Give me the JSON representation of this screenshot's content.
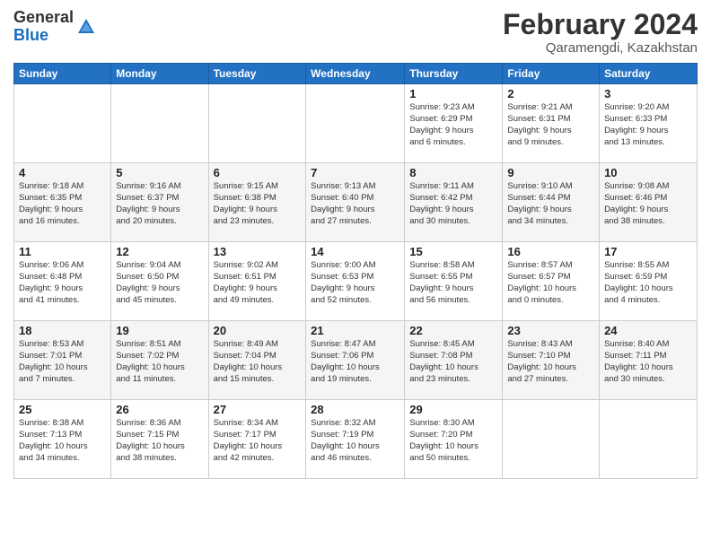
{
  "logo": {
    "general": "General",
    "blue": "Blue"
  },
  "header": {
    "month_year": "February 2024",
    "location": "Qaramengdi, Kazakhstan"
  },
  "days_of_week": [
    "Sunday",
    "Monday",
    "Tuesday",
    "Wednesday",
    "Thursday",
    "Friday",
    "Saturday"
  ],
  "weeks": [
    [
      {
        "day": "",
        "info": ""
      },
      {
        "day": "",
        "info": ""
      },
      {
        "day": "",
        "info": ""
      },
      {
        "day": "",
        "info": ""
      },
      {
        "day": "1",
        "info": "Sunrise: 9:23 AM\nSunset: 6:29 PM\nDaylight: 9 hours\nand 6 minutes."
      },
      {
        "day": "2",
        "info": "Sunrise: 9:21 AM\nSunset: 6:31 PM\nDaylight: 9 hours\nand 9 minutes."
      },
      {
        "day": "3",
        "info": "Sunrise: 9:20 AM\nSunset: 6:33 PM\nDaylight: 9 hours\nand 13 minutes."
      }
    ],
    [
      {
        "day": "4",
        "info": "Sunrise: 9:18 AM\nSunset: 6:35 PM\nDaylight: 9 hours\nand 16 minutes."
      },
      {
        "day": "5",
        "info": "Sunrise: 9:16 AM\nSunset: 6:37 PM\nDaylight: 9 hours\nand 20 minutes."
      },
      {
        "day": "6",
        "info": "Sunrise: 9:15 AM\nSunset: 6:38 PM\nDaylight: 9 hours\nand 23 minutes."
      },
      {
        "day": "7",
        "info": "Sunrise: 9:13 AM\nSunset: 6:40 PM\nDaylight: 9 hours\nand 27 minutes."
      },
      {
        "day": "8",
        "info": "Sunrise: 9:11 AM\nSunset: 6:42 PM\nDaylight: 9 hours\nand 30 minutes."
      },
      {
        "day": "9",
        "info": "Sunrise: 9:10 AM\nSunset: 6:44 PM\nDaylight: 9 hours\nand 34 minutes."
      },
      {
        "day": "10",
        "info": "Sunrise: 9:08 AM\nSunset: 6:46 PM\nDaylight: 9 hours\nand 38 minutes."
      }
    ],
    [
      {
        "day": "11",
        "info": "Sunrise: 9:06 AM\nSunset: 6:48 PM\nDaylight: 9 hours\nand 41 minutes."
      },
      {
        "day": "12",
        "info": "Sunrise: 9:04 AM\nSunset: 6:50 PM\nDaylight: 9 hours\nand 45 minutes."
      },
      {
        "day": "13",
        "info": "Sunrise: 9:02 AM\nSunset: 6:51 PM\nDaylight: 9 hours\nand 49 minutes."
      },
      {
        "day": "14",
        "info": "Sunrise: 9:00 AM\nSunset: 6:53 PM\nDaylight: 9 hours\nand 52 minutes."
      },
      {
        "day": "15",
        "info": "Sunrise: 8:58 AM\nSunset: 6:55 PM\nDaylight: 9 hours\nand 56 minutes."
      },
      {
        "day": "16",
        "info": "Sunrise: 8:57 AM\nSunset: 6:57 PM\nDaylight: 10 hours\nand 0 minutes."
      },
      {
        "day": "17",
        "info": "Sunrise: 8:55 AM\nSunset: 6:59 PM\nDaylight: 10 hours\nand 4 minutes."
      }
    ],
    [
      {
        "day": "18",
        "info": "Sunrise: 8:53 AM\nSunset: 7:01 PM\nDaylight: 10 hours\nand 7 minutes."
      },
      {
        "day": "19",
        "info": "Sunrise: 8:51 AM\nSunset: 7:02 PM\nDaylight: 10 hours\nand 11 minutes."
      },
      {
        "day": "20",
        "info": "Sunrise: 8:49 AM\nSunset: 7:04 PM\nDaylight: 10 hours\nand 15 minutes."
      },
      {
        "day": "21",
        "info": "Sunrise: 8:47 AM\nSunset: 7:06 PM\nDaylight: 10 hours\nand 19 minutes."
      },
      {
        "day": "22",
        "info": "Sunrise: 8:45 AM\nSunset: 7:08 PM\nDaylight: 10 hours\nand 23 minutes."
      },
      {
        "day": "23",
        "info": "Sunrise: 8:43 AM\nSunset: 7:10 PM\nDaylight: 10 hours\nand 27 minutes."
      },
      {
        "day": "24",
        "info": "Sunrise: 8:40 AM\nSunset: 7:11 PM\nDaylight: 10 hours\nand 30 minutes."
      }
    ],
    [
      {
        "day": "25",
        "info": "Sunrise: 8:38 AM\nSunset: 7:13 PM\nDaylight: 10 hours\nand 34 minutes."
      },
      {
        "day": "26",
        "info": "Sunrise: 8:36 AM\nSunset: 7:15 PM\nDaylight: 10 hours\nand 38 minutes."
      },
      {
        "day": "27",
        "info": "Sunrise: 8:34 AM\nSunset: 7:17 PM\nDaylight: 10 hours\nand 42 minutes."
      },
      {
        "day": "28",
        "info": "Sunrise: 8:32 AM\nSunset: 7:19 PM\nDaylight: 10 hours\nand 46 minutes."
      },
      {
        "day": "29",
        "info": "Sunrise: 8:30 AM\nSunset: 7:20 PM\nDaylight: 10 hours\nand 50 minutes."
      },
      {
        "day": "",
        "info": ""
      },
      {
        "day": "",
        "info": ""
      }
    ]
  ]
}
